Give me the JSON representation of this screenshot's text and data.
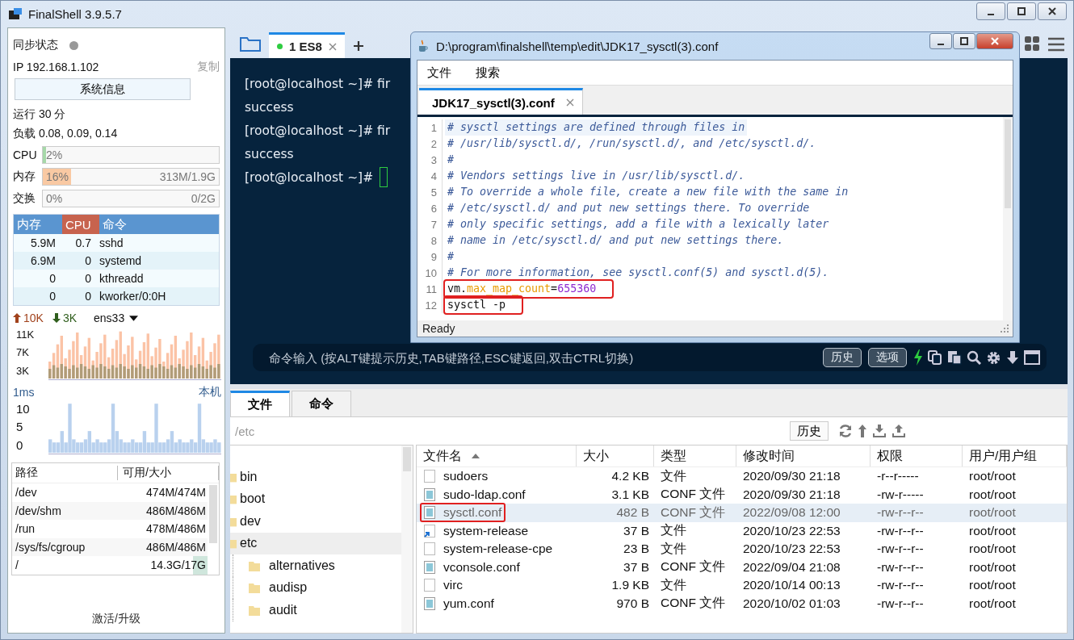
{
  "window": {
    "title": "FinalShell 3.9.5.7"
  },
  "sidebar": {
    "sync": {
      "label": "同步状态",
      "online": false
    },
    "ip": {
      "text": "IP 192.168.1.102",
      "copy": "复制"
    },
    "sysinfo_button": "系统信息",
    "uptime": "运行 30 分",
    "load": "负载 0.08, 0.09, 0.14",
    "meters": [
      {
        "label": "CPU",
        "text": "2%",
        "level": 0.02,
        "color": "#a6d8a8"
      },
      {
        "label": "内存",
        "text": "16%",
        "detail": "313M/1.9G",
        "level": 0.16,
        "color": "#f9c9a3"
      },
      {
        "label": "交换",
        "text": "0%",
        "detail": "0/2G"
      }
    ],
    "processes": {
      "columns": [
        {
          "label": "内存",
          "sorted": false
        },
        {
          "label": "CPU",
          "sorted": true
        },
        {
          "label": "命令",
          "sorted": false
        }
      ],
      "rows": [
        {
          "memory": "5.9M",
          "cpu": "0.7",
          "command": "sshd"
        },
        {
          "memory": "6.9M",
          "cpu": "0",
          "command": "systemd"
        },
        {
          "memory": "0",
          "cpu": "0",
          "command": "kthreadd"
        },
        {
          "memory": "0",
          "cpu": "0",
          "command": "kworker/0:0H"
        }
      ]
    },
    "network": {
      "up": "10K",
      "down": "3K",
      "interface": "ens33",
      "y_ticks": [
        "11K",
        "7K",
        "3K"
      ]
    },
    "ping": {
      "latency": "1ms",
      "host": "本机",
      "y_ticks": [
        "10",
        "5",
        "0"
      ]
    },
    "disks": {
      "columns": [
        "路径",
        "可用/大小"
      ],
      "rows": [
        {
          "path": "/dev",
          "usage": "474M/474M"
        },
        {
          "path": "/dev/shm",
          "usage": "486M/486M"
        },
        {
          "path": "/run",
          "usage": "478M/486M"
        },
        {
          "path": "/sys/fs/cgroup",
          "usage": "486M/486M"
        },
        {
          "path": "/",
          "usage": "14.3G/17G",
          "level": 0.16
        }
      ]
    },
    "upgrade": "激活/升级"
  },
  "session_tabs": [
    {
      "label": "1 ES8",
      "selected": true,
      "connected": true
    }
  ],
  "terminal": {
    "lines": [
      {
        "text": "[root@localhost ~]# fir",
        "cursor": false
      },
      {
        "text": "success",
        "cursor": false
      },
      {
        "text": "[root@localhost ~]# fir",
        "cursor": false
      },
      {
        "text": "success",
        "cursor": false
      },
      {
        "text": "[root@localhost ~]#",
        "cursor": true
      }
    ]
  },
  "command_bar": {
    "placeholder": "命令输入 (按ALT键提示历史,TAB键路径,ESC键返回,双击CTRL切换)",
    "buttons": [
      "历史",
      "选项"
    ]
  },
  "editor": {
    "title": "D:\\program\\finalshell\\temp\\edit\\JDK17_sysctl(3).conf",
    "menu": [
      "文件",
      "搜索"
    ],
    "tabs": [
      {
        "label": "JDK17_sysctl(3).conf",
        "selected": true
      }
    ],
    "lines": [
      {
        "number": "1",
        "current": true,
        "marked": false,
        "segments": [
          {
            "kind": "comment",
            "text": "# sysctl settings are defined through files in"
          }
        ]
      },
      {
        "number": "2",
        "current": false,
        "marked": false,
        "segments": [
          {
            "kind": "comment",
            "text": "# /usr/lib/sysctl.d/, /run/sysctl.d/, and /etc/sysctl.d/."
          }
        ]
      },
      {
        "number": "3",
        "current": false,
        "marked": false,
        "segments": [
          {
            "kind": "comment",
            "text": "#"
          }
        ]
      },
      {
        "number": "4",
        "current": false,
        "marked": false,
        "segments": [
          {
            "kind": "comment",
            "text": "# Vendors settings live in /usr/lib/sysctl.d/."
          }
        ]
      },
      {
        "number": "5",
        "current": false,
        "marked": false,
        "segments": [
          {
            "kind": "comment",
            "text": "# To override a whole file, create a new file with the same in"
          }
        ]
      },
      {
        "number": "6",
        "current": false,
        "marked": false,
        "segments": [
          {
            "kind": "comment",
            "text": "# /etc/sysctl.d/ and put new settings there. To override"
          }
        ]
      },
      {
        "number": "7",
        "current": false,
        "marked": false,
        "segments": [
          {
            "kind": "comment",
            "text": "# only specific settings, add a file with a lexically later"
          }
        ]
      },
      {
        "number": "8",
        "current": false,
        "marked": false,
        "segments": [
          {
            "kind": "comment",
            "text": "# name in /etc/sysctl.d/ and put new settings there."
          }
        ]
      },
      {
        "number": "9",
        "current": false,
        "marked": false,
        "segments": [
          {
            "kind": "comment",
            "text": "#"
          }
        ]
      },
      {
        "number": "10",
        "current": false,
        "marked": false,
        "segments": [
          {
            "kind": "comment",
            "text": "# For more information, see sysctl.conf(5) and sysctl.d(5)."
          }
        ]
      },
      {
        "number": "11",
        "current": false,
        "marked": true,
        "segments": [
          {
            "kind": "plain",
            "text": "vm."
          },
          {
            "kind": "key",
            "text": "max_map_count"
          },
          {
            "kind": "plain",
            "text": "="
          },
          {
            "kind": "number",
            "text": "655360"
          }
        ]
      },
      {
        "number": "12",
        "current": false,
        "marked": true,
        "segments": [
          {
            "kind": "plain",
            "text": "sysctl -p"
          }
        ]
      }
    ],
    "status": "Ready"
  },
  "file_panel": {
    "tabs": [
      {
        "label": "文件",
        "selected": true
      },
      {
        "label": "命令",
        "selected": false
      }
    ],
    "path": "/etc",
    "history_button": "历史",
    "tree": [
      {
        "name": "bin",
        "selected": false
      },
      {
        "name": "boot",
        "selected": false
      },
      {
        "name": "dev",
        "selected": false
      },
      {
        "name": "etc",
        "selected": true,
        "children": [
          {
            "name": "alternatives",
            "selected": false
          },
          {
            "name": "audisp",
            "selected": false
          },
          {
            "name": "audit",
            "selected": false
          }
        ]
      }
    ],
    "table": {
      "columns": [
        {
          "label": "文件名",
          "sorted": true
        },
        {
          "label": "大小",
          "sorted": false
        },
        {
          "label": "类型",
          "sorted": false
        },
        {
          "label": "修改时间",
          "sorted": false
        },
        {
          "label": "权限",
          "sorted": false
        },
        {
          "label": "用户/用户组",
          "sorted": false
        }
      ],
      "rows": [
        {
          "kind": "file",
          "name": "sudoers",
          "size": "4.2 KB",
          "type": "文件",
          "modified": "2020/09/30 21:18",
          "permissions": "-r--r-----",
          "owner": "root/root",
          "selected": false,
          "marked": false
        },
        {
          "kind": "conf",
          "name": "sudo-ldap.conf",
          "size": "3.1 KB",
          "type": "CONF 文件",
          "modified": "2020/09/30 21:18",
          "permissions": "-rw-r-----",
          "owner": "root/root",
          "selected": false,
          "marked": false
        },
        {
          "kind": "conf",
          "name": "sysctl.conf",
          "size": "482 B",
          "type": "CONF 文件",
          "modified": "2022/09/08 12:00",
          "permissions": "-rw-r--r--",
          "owner": "root/root",
          "selected": true,
          "marked": true
        },
        {
          "kind": "link",
          "name": "system-release",
          "size": "37 B",
          "type": "文件",
          "modified": "2020/10/23 22:53",
          "permissions": "-rw-r--r--",
          "owner": "root/root",
          "selected": false,
          "marked": false
        },
        {
          "kind": "file",
          "name": "system-release-cpe",
          "size": "23 B",
          "type": "文件",
          "modified": "2020/10/23 22:53",
          "permissions": "-rw-r--r--",
          "owner": "root/root",
          "selected": false,
          "marked": false
        },
        {
          "kind": "conf",
          "name": "vconsole.conf",
          "size": "37 B",
          "type": "CONF 文件",
          "modified": "2022/09/04 21:08",
          "permissions": "-rw-r--r--",
          "owner": "root/root",
          "selected": false,
          "marked": false
        },
        {
          "kind": "file",
          "name": "virc",
          "size": "1.9 KB",
          "type": "文件",
          "modified": "2020/10/14 00:13",
          "permissions": "-rw-r--r--",
          "owner": "root/root",
          "selected": false,
          "marked": false
        },
        {
          "kind": "conf",
          "name": "yum.conf",
          "size": "970 B",
          "type": "CONF 文件",
          "modified": "2020/10/02 01:03",
          "permissions": "-rw-r--r--",
          "owner": "root/root",
          "selected": false,
          "marked": false
        }
      ]
    }
  }
}
